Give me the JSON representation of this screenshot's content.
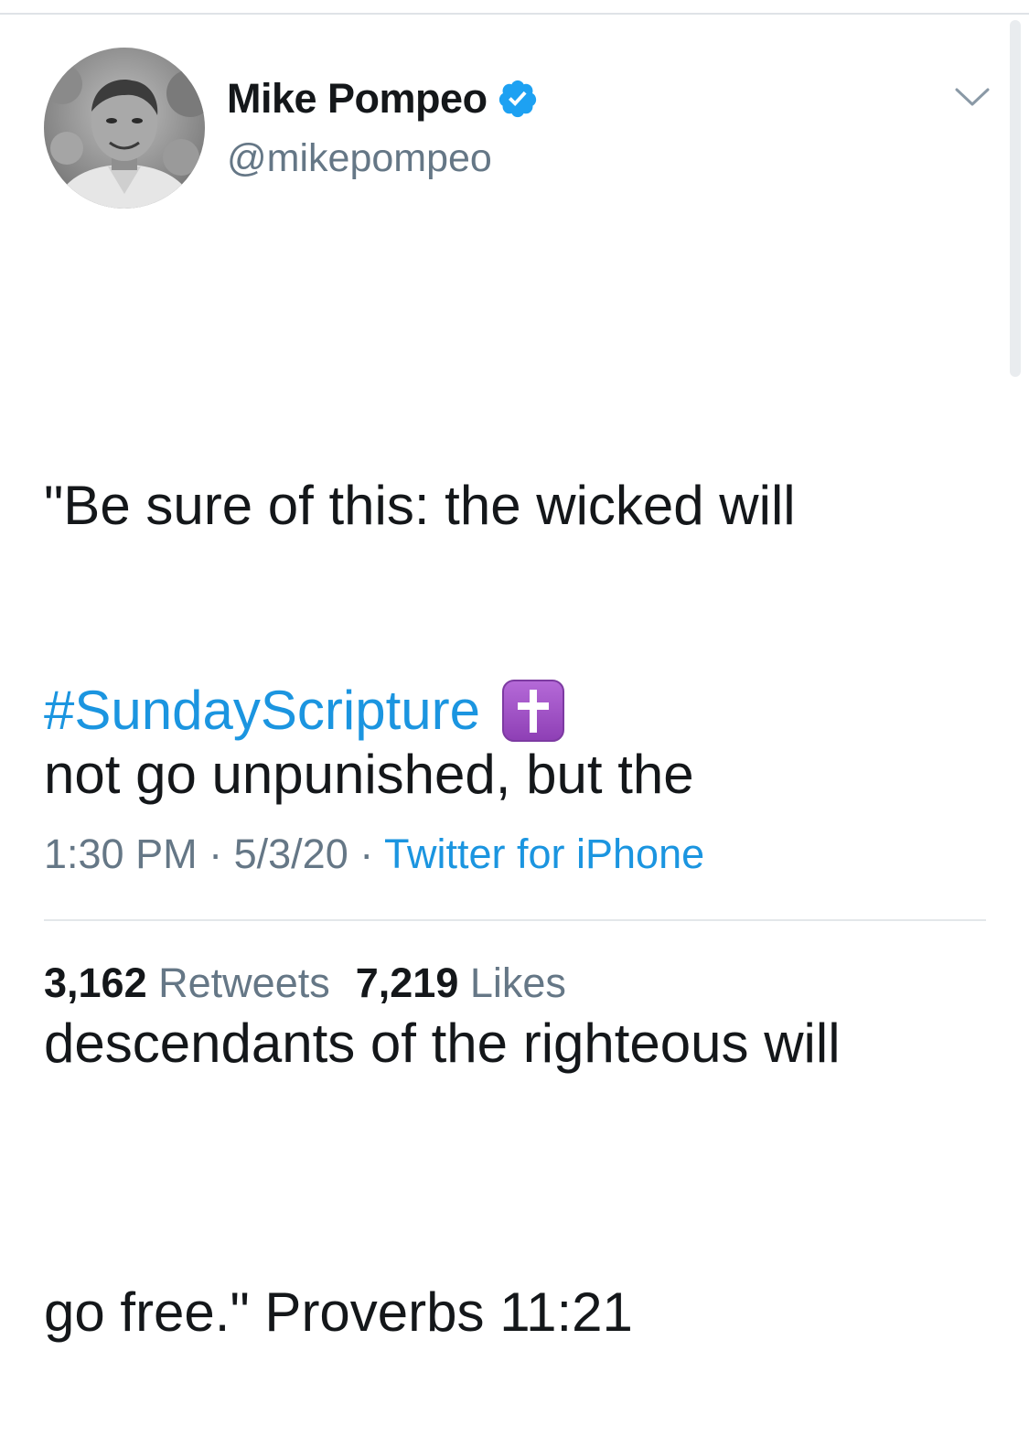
{
  "tweet": {
    "author": {
      "name": "Mike Pompeo",
      "handle": "@mikepompeo",
      "verified": true
    },
    "text_lines": [
      "\"Be sure of this: the wicked will",
      "not go unpunished, but the",
      "descendants of the righteous will",
      "go free.\" Proverbs 11:21"
    ],
    "hashtag": "#SundayScripture",
    "emoji": "latin-cross-icon",
    "time": "1:30 PM",
    "date": "5/3/20",
    "separator": "·",
    "source": "Twitter for iPhone",
    "stats": {
      "retweets_count": "3,162",
      "retweets_label": "Retweets",
      "likes_count": "7,219",
      "likes_label": "Likes"
    }
  },
  "colors": {
    "text": "#14171a",
    "secondary": "#657786",
    "link": "#1b95e0",
    "verified_badge": "#1da1f2",
    "emoji_purple": "#9b59b6"
  }
}
